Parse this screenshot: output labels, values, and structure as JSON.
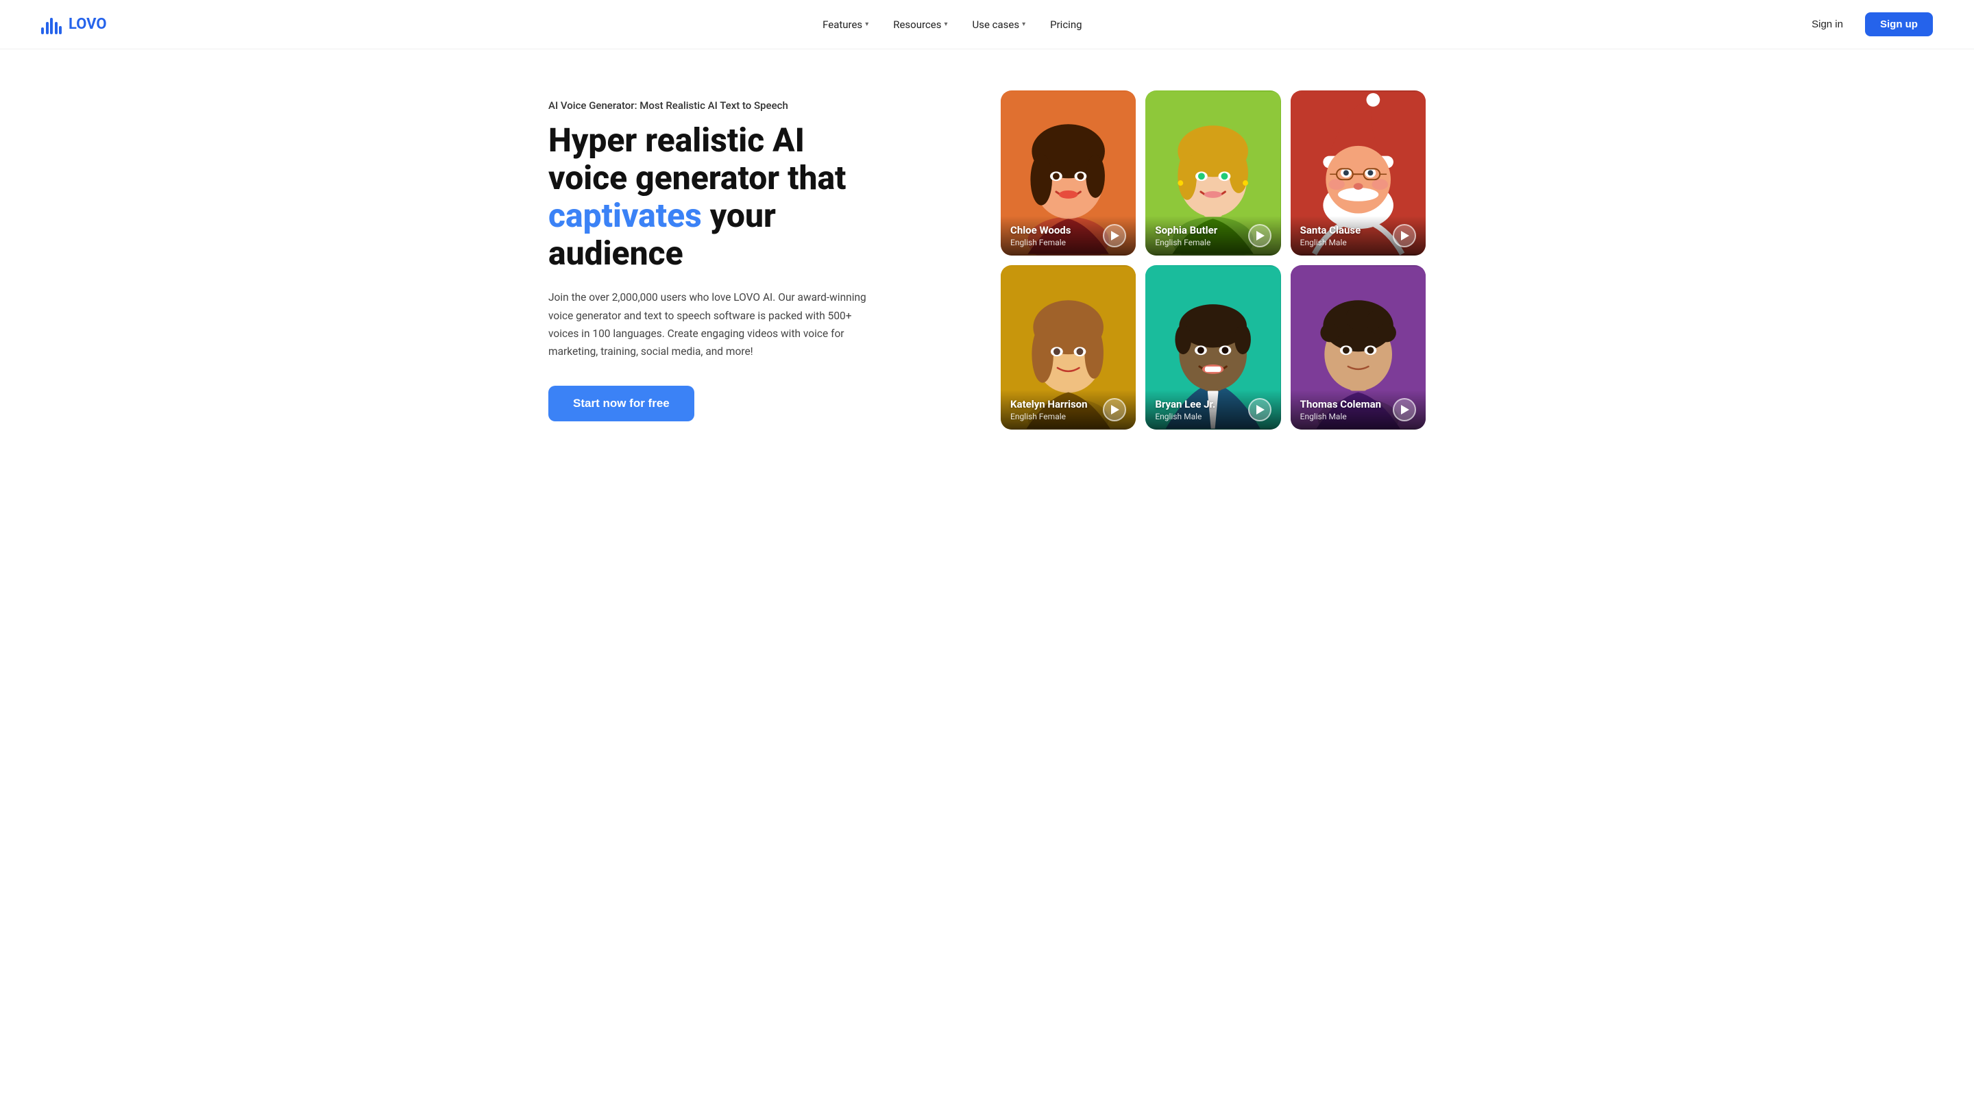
{
  "nav": {
    "logo_text": "LOVO",
    "links": [
      {
        "label": "Features",
        "has_dropdown": true
      },
      {
        "label": "Resources",
        "has_dropdown": true
      },
      {
        "label": "Use cases",
        "has_dropdown": true
      },
      {
        "label": "Pricing",
        "has_dropdown": false
      }
    ],
    "signin_label": "Sign in",
    "signup_label": "Sign up"
  },
  "hero": {
    "subtitle": "AI Voice Generator: Most Realistic AI Text to Speech",
    "title_part1": "Hyper realistic AI voice generator that ",
    "title_accent": "captivates",
    "title_part2": " your audience",
    "description": "Join the over 2,000,000 users who love LOVO AI. Our award-winning voice generator and text to speech software is packed with 500+ voices in 100 languages. Create engaging videos with voice for marketing, training, social media, and more!",
    "cta_label": "Start now for free"
  },
  "voices": [
    {
      "id": "chloe-woods",
      "name": "Chloe Woods",
      "language": "English Female",
      "color_class": "card-orange",
      "emoji": "👩"
    },
    {
      "id": "sophia-butler",
      "name": "Sophia Butler",
      "language": "English Female",
      "color_class": "card-green",
      "emoji": "👩‍🦳"
    },
    {
      "id": "santa-clause",
      "name": "Santa Clause",
      "language": "English Male",
      "color_class": "card-red",
      "emoji": "🎅"
    },
    {
      "id": "katelyn-harrison",
      "name": "Katelyn Harrison",
      "language": "English Female",
      "color_class": "card-gold",
      "emoji": "👩‍🦱"
    },
    {
      "id": "bryan-lee-jr",
      "name": "Bryan Lee Jr.",
      "language": "English Male",
      "color_class": "card-cyan",
      "emoji": "👨🏾"
    },
    {
      "id": "thomas-coleman",
      "name": "Thomas Coleman",
      "language": "English Male",
      "color_class": "card-purple",
      "emoji": "👨‍🦱"
    }
  ]
}
